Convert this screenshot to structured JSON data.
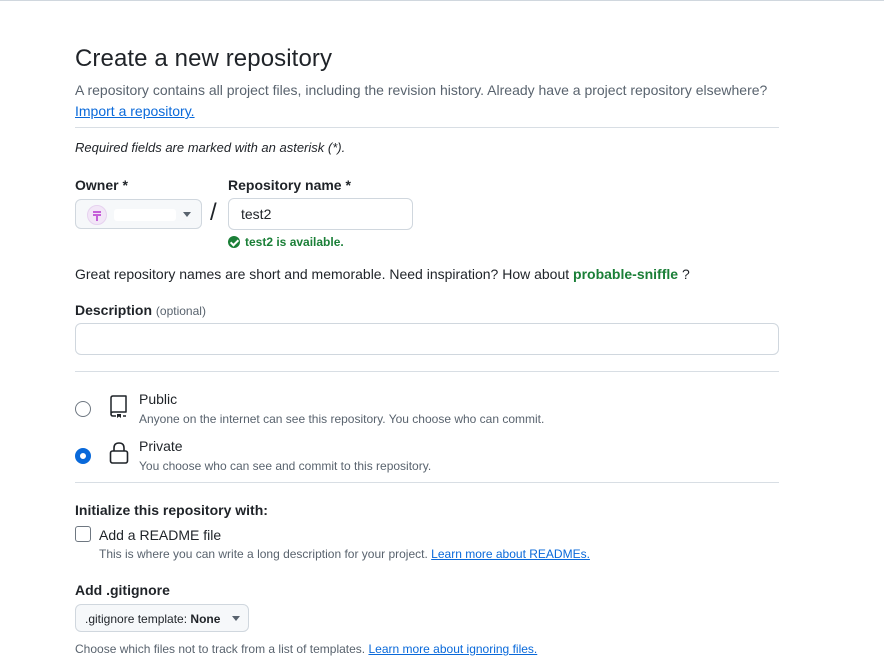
{
  "header": {
    "title": "Create a new repository",
    "subtitle": "A repository contains all project files, including the revision history. Already have a project repository elsewhere?",
    "import_link": "Import a repository."
  },
  "required_note": "Required fields are marked with an asterisk (*).",
  "owner": {
    "label": "Owner *"
  },
  "repo": {
    "label": "Repository name *",
    "separator": "/",
    "value": "test2",
    "availability": "test2 is available."
  },
  "inspiration": {
    "text": "Great repository names are short and memorable. Need inspiration? How about",
    "suggestion": "probable-sniffle",
    "suffix": "?"
  },
  "description": {
    "label": "Description",
    "optional": "(optional)",
    "value": ""
  },
  "visibility": {
    "options": [
      {
        "title": "Public",
        "note": "Anyone on the internet can see this repository. You choose who can commit.",
        "selected": false
      },
      {
        "title": "Private",
        "note": "You choose who can see and commit to this repository.",
        "selected": true
      }
    ]
  },
  "initialize": {
    "heading": "Initialize this repository with:",
    "readme_label": "Add a README file",
    "readme_checked": false,
    "readme_note": "This is where you can write a long description for your project.",
    "readme_link": "Learn more about READMEs."
  },
  "gitignore": {
    "heading": "Add .gitignore",
    "select_prefix": ".gitignore template:",
    "select_value": "None",
    "note": "Choose which files not to track from a list of templates.",
    "link": "Learn more about ignoring files."
  },
  "icons": {
    "public": "repo-book-icon",
    "private": "lock-icon",
    "available": "check-circle-icon"
  },
  "colors": {
    "link": "#0969da",
    "success": "#1a7f37",
    "radio_selected": "#0969da"
  }
}
